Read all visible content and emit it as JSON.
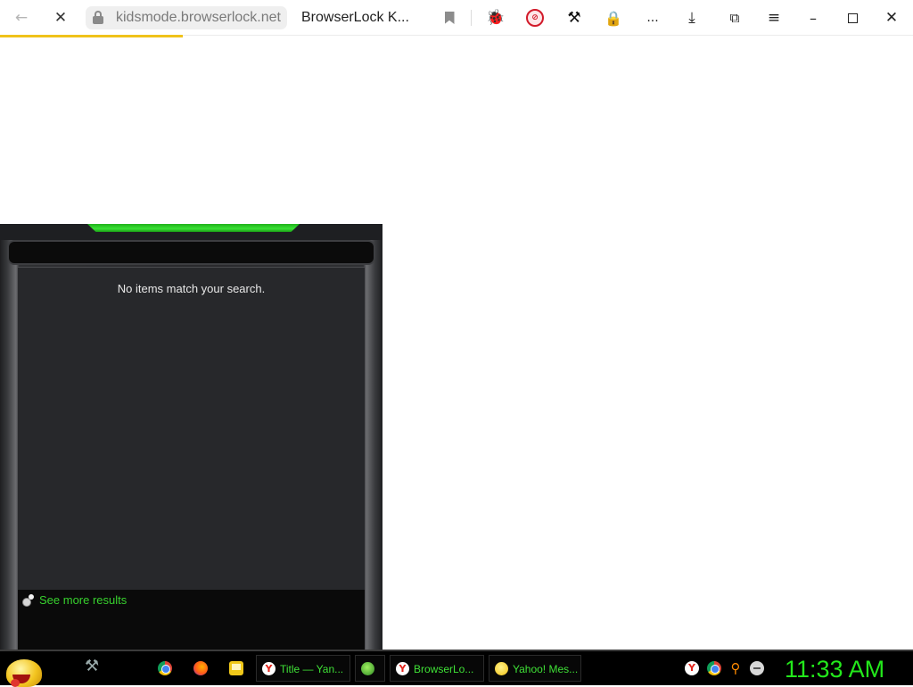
{
  "browser": {
    "url": "kidsmode.browserlock.net",
    "tab_title": "BrowserLock K...",
    "overflow_label": "...",
    "load_progress": 0.2,
    "accent_progress_color": "#f0c21a"
  },
  "icons": {
    "back": "back-arrow-icon",
    "stop": "stop-loading-icon",
    "lock": "lock-icon",
    "bookmark": "bookmark-icon",
    "extensions": [
      "ladybug-icon",
      "block-icon",
      "tools-icon",
      "padlock-icon"
    ],
    "download": "download-icon",
    "collections": "collections-icon",
    "menu": "menu-icon",
    "window_controls": [
      "minimize-icon",
      "maximize-icon",
      "close-icon"
    ]
  },
  "panel": {
    "empty_message": "No items match your search.",
    "see_more": "See more results",
    "accent_color": "#38d12e"
  },
  "taskbar": {
    "quick_launch": [
      "chrome-icon",
      "firefox-icon",
      "notes-icon"
    ],
    "tasks": [
      {
        "icon": "yandex-icon",
        "label": "Title — Yan..."
      },
      {
        "icon": "app-icon",
        "label": ""
      },
      {
        "icon": "yandex-icon",
        "label": "BrowserLo..."
      },
      {
        "icon": "yahoo-messenger-icon",
        "label": "Yahoo! Mes..."
      }
    ],
    "tray": [
      "yandex-icon",
      "chrome-icon",
      "search-icon",
      "messenger-icon"
    ],
    "clock": "11:33 AM",
    "clock_color": "#23e81b"
  }
}
